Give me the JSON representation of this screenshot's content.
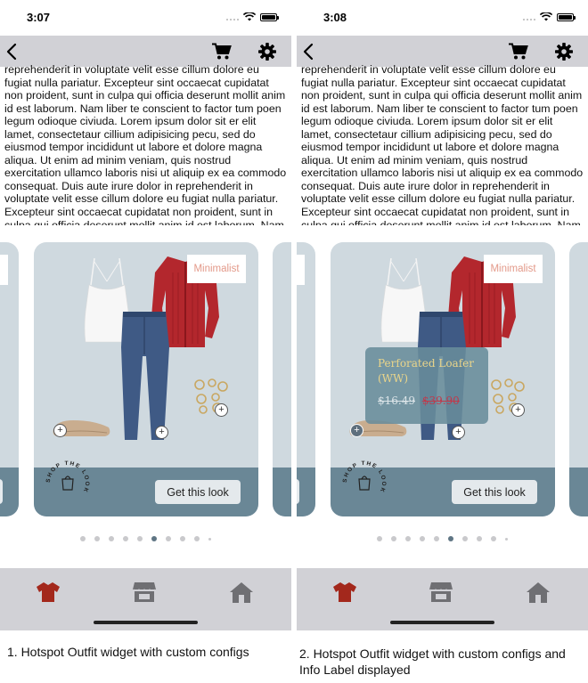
{
  "screens": [
    {
      "time": "3:07",
      "show_info_label": false
    },
    {
      "time": "3:08",
      "show_info_label": true
    }
  ],
  "body_text": "reprehenderit in voluptate velit esse cillum dolore eu fugiat nulla pariatur. Excepteur sint occaecat cupidatat non proident, sunt in culpa qui officia deserunt mollit anim id est laborum. Nam liber te conscient to factor tum poen legum odioque civiuda. Lorem ipsum dolor sit er elit lamet, consectetaur cillium adipisicing pecu, sed do eiusmod tempor incididunt ut labore et dolore magna aliqua. Ut enim ad minim veniam, quis nostrud exercitation ullamco laboris nisi ut aliquip ex ea commodo consequat. Duis aute irure dolor in reprehenderit in voluptate velit esse cillum dolore eu fugiat nulla pariatur. Excepteur sint occaecat cupidatat non proident, sunt in culpa qui officia deserunt mollit anim id est laborum. Nam liber te conscient to factor",
  "card": {
    "style_tag": "Minimalist",
    "button_label": "Get this look",
    "shop_badge_text": "SHOP THE LOOK",
    "hotspot_symbol": "+"
  },
  "info_label": {
    "name": "Perforated Loafer (WW)",
    "sale_price": "$16.49",
    "original_price": "$39.90"
  },
  "pagination": {
    "count": 10,
    "active_index": 5
  },
  "tabbar": {
    "items": [
      {
        "icon": "shirt-icon",
        "active": true
      },
      {
        "icon": "store-icon",
        "active": false
      },
      {
        "icon": "home-icon",
        "active": false
      }
    ]
  },
  "colors": {
    "nav_bg": "#d1d1d6",
    "card_bg": "#cfd9df",
    "card_band": "#6a8796",
    "tab_active": "#a3281c",
    "tab_inactive": "#6f6f73",
    "style_tag_text": "#e39a8a"
  },
  "captions": [
    "1. Hotspot Outfit widget with custom configs",
    "2. Hotspot Outfit widget with custom configs and Info Label displayed"
  ]
}
